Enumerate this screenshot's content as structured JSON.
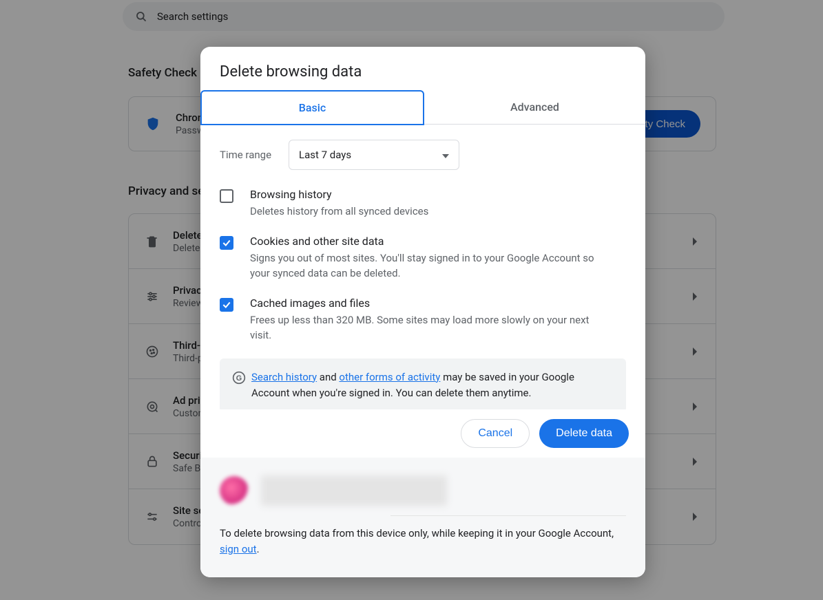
{
  "search": {
    "placeholder": "Search settings"
  },
  "sections": {
    "safety_title": "Safety Check",
    "privacy_title": "Privacy and security"
  },
  "safety_card": {
    "title": "Chrome found some safety recommendations for your review",
    "subtitle": "Passwords, extensions, and more",
    "button": "Safety Check"
  },
  "list": [
    {
      "title": "Delete browsing data",
      "subtitle": "Delete history, cookies, cache, and more"
    },
    {
      "title": "Privacy Guide",
      "subtitle": "Review key privacy and security controls"
    },
    {
      "title": "Third-party cookies",
      "subtitle": "Third-party cookies are blocked"
    },
    {
      "title": "Ad privacy",
      "subtitle": "Customize the info used by sites to show you ads"
    },
    {
      "title": "Security",
      "subtitle": "Safe Browsing (protection from dangerous sites) and other security settings"
    },
    {
      "title": "Site settings",
      "subtitle": "Controls what information sites can use and show"
    }
  ],
  "dialog": {
    "title": "Delete browsing data",
    "tabs": {
      "basic": "Basic",
      "advanced": "Advanced"
    },
    "time_label": "Time range",
    "time_value": "Last 7 days",
    "options": [
      {
        "checked": false,
        "title": "Browsing history",
        "subtitle": "Deletes history from all synced devices"
      },
      {
        "checked": true,
        "title": "Cookies and other site data",
        "subtitle": "Signs you out of most sites. You'll stay signed in to your Google Account so your synced data can be deleted."
      },
      {
        "checked": true,
        "title": "Cached images and files",
        "subtitle": "Frees up less than 320 MB. Some sites may load more slowly on your next visit."
      }
    ],
    "info": {
      "link1": "Search history",
      "mid1": " and ",
      "link2": "other forms of activity",
      "rest": " may be saved in your Google Account when you're signed in. You can delete them anytime."
    },
    "cancel": "Cancel",
    "confirm": "Delete data",
    "signout_pre": "To delete browsing data from this device only, while keeping it in your Google Account, ",
    "signout_link": "sign out",
    "signout_post": "."
  }
}
